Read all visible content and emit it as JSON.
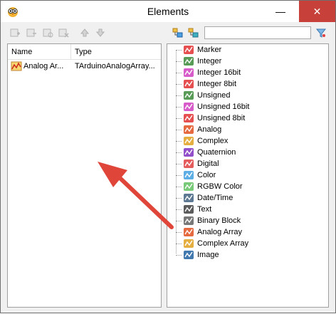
{
  "window": {
    "title": "Elements"
  },
  "titlebar": {
    "minimize_glyph": "—",
    "close_glyph": "✕"
  },
  "toolbar": {
    "left_icons": [
      "add-element-icon",
      "remove-element-icon",
      "properties-icon",
      "delete-icon",
      "move-up-icon",
      "move-down-icon"
    ],
    "right_icons": [
      "expand-tree-icon",
      "collapse-tree-icon"
    ],
    "filter": {
      "value": "",
      "placeholder": ""
    },
    "filter_icon": "funnel-icon"
  },
  "left_table": {
    "columns": [
      "Name",
      "Type"
    ],
    "rows": [
      {
        "name": "Analog Ar...",
        "type": "TArduinoAnalogArray...",
        "icon": "analog-array-icon"
      }
    ]
  },
  "tree": {
    "items": [
      {
        "label": "Marker",
        "icon": "marker-icon",
        "color": "#e03030"
      },
      {
        "label": "Integer",
        "icon": "integer-icon",
        "color": "#3a8a3a"
      },
      {
        "label": "Integer 16bit",
        "icon": "integer-16bit-icon",
        "color": "#d040c0"
      },
      {
        "label": "Integer 8bit",
        "icon": "integer-8bit-icon",
        "color": "#e03030"
      },
      {
        "label": "Unsigned",
        "icon": "unsigned-icon",
        "color": "#3a8a3a"
      },
      {
        "label": "Unsigned 16bit",
        "icon": "unsigned-16bit-icon",
        "color": "#d040c0"
      },
      {
        "label": "Unsigned 8bit",
        "icon": "unsigned-8bit-icon",
        "color": "#e03030"
      },
      {
        "label": "Analog",
        "icon": "analog-icon",
        "color": "#e05020"
      },
      {
        "label": "Complex",
        "icon": "complex-icon",
        "color": "#e0a020"
      },
      {
        "label": "Quaternion",
        "icon": "quaternion-icon",
        "color": "#8030c0"
      },
      {
        "label": "Digital",
        "icon": "digital-icon",
        "color": "#e04040"
      },
      {
        "label": "Color",
        "icon": "color-icon",
        "color": "#40a0e0"
      },
      {
        "label": "RGBW Color",
        "icon": "rgbw-color-icon",
        "color": "#60c060"
      },
      {
        "label": "Date/Time",
        "icon": "date-time-icon",
        "color": "#406080"
      },
      {
        "label": "Text",
        "icon": "text-icon",
        "color": "#404040"
      },
      {
        "label": "Binary Block",
        "icon": "binary-block-icon",
        "color": "#606060"
      },
      {
        "label": "Analog Array",
        "icon": "analog-array-icon",
        "color": "#e05020"
      },
      {
        "label": "Complex Array",
        "icon": "complex-array-icon",
        "color": "#e0a020"
      },
      {
        "label": "Image",
        "icon": "image-icon",
        "color": "#2060a0"
      }
    ]
  },
  "annotation": {
    "arrow_color": "#e0453a"
  }
}
